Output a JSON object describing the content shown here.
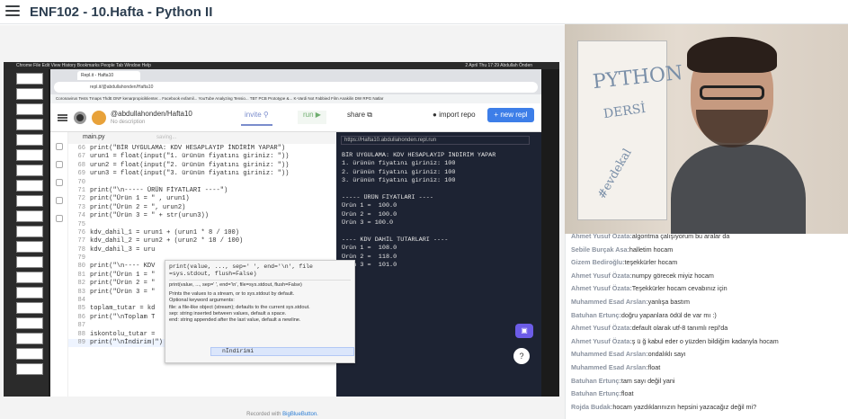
{
  "header": {
    "title": "ENF102 - 10.Hafta - Python II"
  },
  "mac_menubar": "Chrome   File   Edit   View   History   Bookmarks   People   Tab   Window   Help",
  "mac_status": "2 April Thu 17:29   Abdullah Önden",
  "browser": {
    "tab_title": "Repl.it - Hafta10",
    "url": "repl.it/@abdullahonden/Hafta10",
    "bookmarks": "Coronavirus Tests   Tmaps ThdE DNF   kenarpropiciklienter...   Facebook exfamil...   YouTube   Analyzing Tensio...   TBT   PCB Prototype &...   K-Vardi   Not Fabbied   Film   Anakilin   DW RPG   Natlar"
  },
  "repl": {
    "user_path": "@abdullahonden/Hafta10",
    "description": "No description",
    "invite": "invite",
    "run": "run",
    "share": "share",
    "import": "import repo",
    "new_repl": "+ new repl",
    "file_tab": "main.py",
    "saving": "saving...",
    "console_url": "https://Hafta10.abdullahonden.repl.run"
  },
  "code_lines": [
    {
      "n": "66",
      "t": "print(\"BİR UYGULAMA: KDV HESAPLAYIP İNDİRİM YAPAR\")"
    },
    {
      "n": "67",
      "t": "urun1 = float(input(\"1. ürünün fiyatını giriniz: \"))"
    },
    {
      "n": "68",
      "t": "urun2 = float(input(\"2. ürünün fiyatını giriniz: \"))"
    },
    {
      "n": "69",
      "t": "urun3 = float(input(\"3. ürünün fiyatını giriniz: \"))"
    },
    {
      "n": "70",
      "t": ""
    },
    {
      "n": "71",
      "t": "print(\"\\n----- ÜRÜN FİYATLARI ----\")"
    },
    {
      "n": "72",
      "t": "print(\"Ürün 1 = \" , urun1)"
    },
    {
      "n": "73",
      "t": "print(\"Ürün 2 = \", urun2)"
    },
    {
      "n": "74",
      "t": "print(\"Ürün 3 = \" + str(urun3))"
    },
    {
      "n": "75",
      "t": ""
    },
    {
      "n": "76",
      "t": "kdv_dahil_1 = urun1 + (urun1 * 8 / 100)"
    },
    {
      "n": "77",
      "t": "kdv_dahil_2 = urun2 + (urun2 * 18 / 100)"
    },
    {
      "n": "78",
      "t": "kdv_dahil_3 = uru"
    },
    {
      "n": "79",
      "t": ""
    },
    {
      "n": "80",
      "t": "print(\"\\n---- KDV"
    },
    {
      "n": "81",
      "t": "print(\"Ürün 1 = \""
    },
    {
      "n": "82",
      "t": "print(\"Ürün 2 = \""
    },
    {
      "n": "83",
      "t": "print(\"Ürün 3 = \""
    },
    {
      "n": "84",
      "t": ""
    },
    {
      "n": "85",
      "t": "toplam_tutar = kd"
    },
    {
      "n": "86",
      "t": "print(\"\\nToplam T"
    },
    {
      "n": "87",
      "t": ""
    },
    {
      "n": "88",
      "t": "iskontolu_tutar = "
    },
    {
      "n": "89",
      "t": "print(\"\\nİndirim|\")"
    }
  ],
  "tooltip": {
    "signature": "print(value, ..., sep=' ', end='\\n', file\n=sys.stdout, flush=False)",
    "signature2": "print(value, ..., sep=' ', end='\\n', file=sys.stdout, flush=False)",
    "doc1": "Prints the values to a stream, or to sys.stdout by default.",
    "doc2": "Optional keyword arguments:",
    "doc3": "file: a file-like object (stream); defaults to the current sys.stdout.",
    "doc4": "sep:  string inserted between values, default a space.",
    "doc5": "end:  string appended after the last value, default a newline.",
    "suggestion": "nİndirimi"
  },
  "console_output": "BİR UYGULAMA: KDV HESAPLAYIP İNDİRİM YAPAR\n1. ürünün fiyatını giriniz: 100\n2. ürünün fiyatını giriniz: 100\n3. ürünün fiyatını giriniz: 100\n\n----- ÜRÜN FİYATLARI ----\nÜrün 1 =  100.0\nÜrün 2 =  100.0\nÜrün 3 = 100.0\n\n---- KDV DAHİL TUTARLARI ----\nÜrün 1 =  108.0\nÜrün 2 =  118.0\nÜrün 3 =  101.0",
  "recorded": {
    "prefix": "Recorded with ",
    "brand": "BigBlueButton."
  },
  "whiteboard": {
    "w1": "PYTHON",
    "w2": "DERSİ",
    "w3": "#evdekal"
  },
  "chat": [
    {
      "who": "Ahmet Yusuf Özata:",
      "msg": "algoritma çalışıyorum bu aralar da"
    },
    {
      "who": "Sebile Burçak Asa:",
      "msg": "halletim hocam"
    },
    {
      "who": "Gizem Bediroğlu:",
      "msg": "teşekkürler hocam"
    },
    {
      "who": "Ahmet Yusuf Özata:",
      "msg": "numpy görecek miyiz hocam"
    },
    {
      "who": "Ahmet Yusuf Özata:",
      "msg": "Teşekkürler hocam cevabınız için"
    },
    {
      "who": "Muhammed Esad Arslan:",
      "msg": "yanlışa bastım"
    },
    {
      "who": "Batuhan Ertunç:",
      "msg": "doğru yapanlara ödül de var mı :)"
    },
    {
      "who": "Ahmet Yusuf Özata:",
      "msg": "default olarak utf-8 tanımlı repl'da"
    },
    {
      "who": "Ahmet Yusuf Özata:",
      "msg": "ş ü ğ kabul eder o yüzden bildiğim kadanyla hocam"
    },
    {
      "who": "Muhammed Esad Arslan:",
      "msg": "ondalıklı sayı"
    },
    {
      "who": "Muhammed Esad Arslan:",
      "msg": "float"
    },
    {
      "who": "Batuhan Ertunç:",
      "msg": "tam sayı değil yani"
    },
    {
      "who": "Batuhan Ertunç:",
      "msg": "float"
    },
    {
      "who": "Rojda Budak:",
      "msg": "hocam yazdıklarınızın hepsini yazacağız değil mi?"
    }
  ]
}
